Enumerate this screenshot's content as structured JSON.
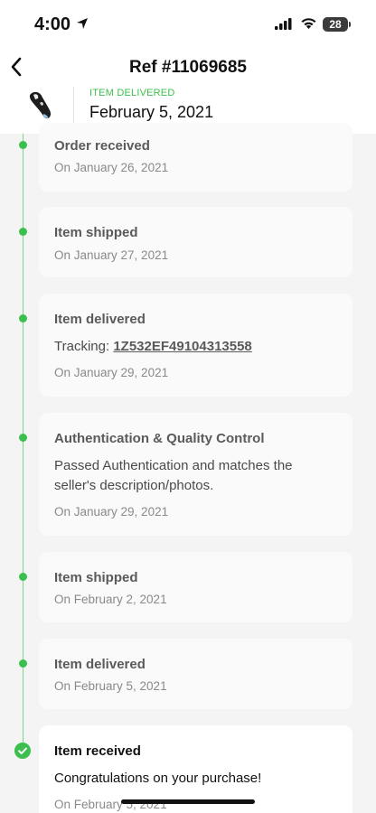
{
  "status_bar": {
    "time": "4:00",
    "battery": "28"
  },
  "header": {
    "title": "Ref #11069685",
    "status_label": "ITEM DELIVERED",
    "status_date": "February 5, 2021"
  },
  "colors": {
    "accent_green": "#3cbf4e",
    "timeline_line": "#7fd48b"
  },
  "timeline": [
    {
      "title": "Order received",
      "date": "On January 26, 2021"
    },
    {
      "title": "Item shipped",
      "date": "On January 27, 2021"
    },
    {
      "title": "Item delivered",
      "tracking_label": "Tracking:",
      "tracking_number": "1Z532EF49104313558",
      "date": "On January 29, 2021"
    },
    {
      "title": "Authentication & Quality Control",
      "text_line1": "Passed Authentication and matches the",
      "text_line2": "seller's description/photos.",
      "date": "On January 29, 2021"
    },
    {
      "title": "Item shipped",
      "date": "On February 2, 2021"
    },
    {
      "title": "Item delivered",
      "date": "On February 5, 2021"
    },
    {
      "title": "Item received",
      "text": "Congratulations on your purchase!",
      "date": "On February 5, 2021"
    }
  ]
}
